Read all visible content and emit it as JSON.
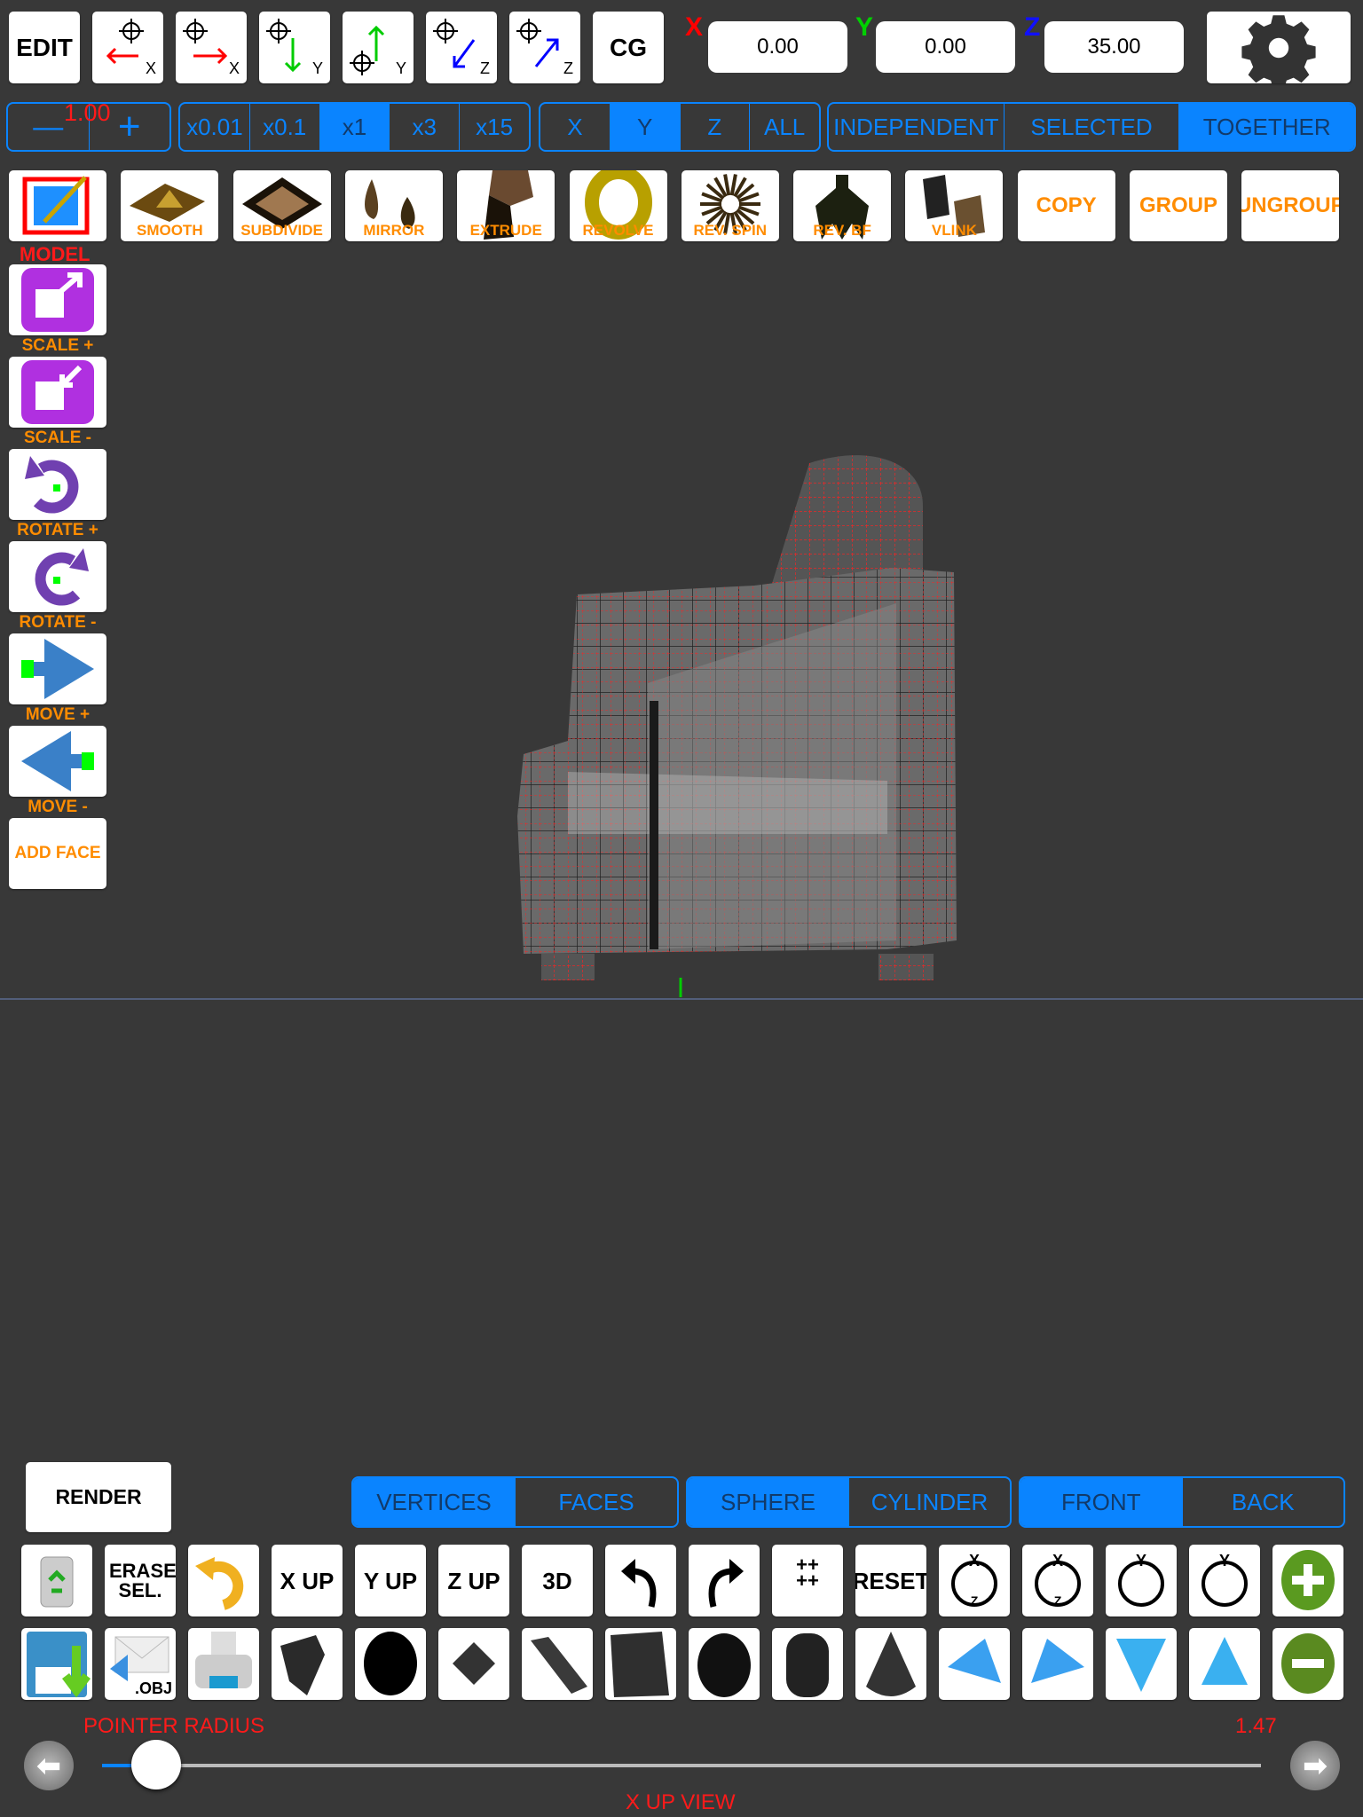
{
  "top_toolbar": {
    "edit_label": "EDIT",
    "cg_label": "CG",
    "axis_buttons": [
      {
        "icon": "move-pointer-left-x-icon",
        "axis": "X"
      },
      {
        "icon": "move-pointer-right-x-icon",
        "axis": "X"
      },
      {
        "icon": "move-pointer-down-y-icon",
        "axis": "Y"
      },
      {
        "icon": "move-pointer-up-y-icon",
        "axis": "Y"
      },
      {
        "icon": "move-pointer-toward-z-icon",
        "axis": "Z"
      },
      {
        "icon": "move-pointer-away-z-icon",
        "axis": "Z"
      }
    ],
    "coords": {
      "x_label": "X",
      "x_value": "0.00",
      "y_label": "Y",
      "y_value": "0.00",
      "z_label": "Z",
      "z_value": "35.00"
    },
    "settings_icon": "gear-icon"
  },
  "controls_row": {
    "stepper": {
      "minus": "—",
      "plus": "+",
      "value": "1.00"
    },
    "scale_options": [
      "x0.01",
      "x0.1",
      "x1",
      "x3",
      "x15"
    ],
    "scale_selected": "x1",
    "axis_options": [
      "X",
      "Y",
      "Z",
      "ALL"
    ],
    "axis_selected": "Y",
    "mode_options": [
      "INDEPENDENT",
      "SELECTED",
      "TOGETHER"
    ],
    "mode_selected": "TOGETHER"
  },
  "tools_row": [
    {
      "label": "",
      "icon": "model-edit-icon"
    },
    {
      "label": "SMOOTH",
      "icon": "smooth-icon"
    },
    {
      "label": "SUBDIVIDE",
      "icon": "subdivide-icon"
    },
    {
      "label": "MIRROR",
      "icon": "mirror-icon"
    },
    {
      "label": "EXTRUDE",
      "icon": "extrude-icon"
    },
    {
      "label": "REVOLVE",
      "icon": "revolve-icon"
    },
    {
      "label": "REV. SPIN",
      "icon": "rev-spin-icon"
    },
    {
      "label": "REV. BF",
      "icon": "rev-bf-icon"
    },
    {
      "label": "VLINK",
      "icon": "vlink-icon"
    },
    {
      "label": "COPY",
      "icon": ""
    },
    {
      "label": "GROUP",
      "icon": ""
    },
    {
      "label": "UNGROUP",
      "icon": ""
    }
  ],
  "model_label": "MODEL",
  "left_tools": [
    {
      "label": "SCALE +",
      "icon": "scale-up-icon"
    },
    {
      "label": "SCALE -",
      "icon": "scale-down-icon"
    },
    {
      "label": "ROTATE +",
      "icon": "rotate-ccw-icon"
    },
    {
      "label": "ROTATE -",
      "icon": "rotate-cw-icon"
    },
    {
      "label": "MOVE +",
      "icon": "move-right-icon"
    },
    {
      "label": "MOVE -",
      "icon": "move-left-icon"
    }
  ],
  "add_face_label": "ADD FACE",
  "bottom": {
    "render_label": "RENDER",
    "select_type": {
      "options": [
        "VERTICES",
        "FACES"
      ],
      "selected": "VERTICES"
    },
    "brush_shape": {
      "options": [
        "SPHERE",
        "CYLINDER"
      ],
      "selected": "SPHERE"
    },
    "side": {
      "options": [
        "FRONT",
        "BACK"
      ],
      "selected": "FRONT"
    },
    "row1": [
      {
        "icon": "trash-icon",
        "label": ""
      },
      {
        "icon": "",
        "label": "ERASE SEL."
      },
      {
        "icon": "undo-arrow-icon",
        "label": ""
      },
      {
        "icon": "",
        "label": "X UP"
      },
      {
        "icon": "",
        "label": "Y UP"
      },
      {
        "icon": "",
        "label": "Z UP"
      },
      {
        "icon": "",
        "label": "3D"
      },
      {
        "icon": "undo-icon",
        "label": ""
      },
      {
        "icon": "redo-icon",
        "label": ""
      },
      {
        "icon": "grid-points-icon",
        "label": ""
      },
      {
        "icon": "",
        "label": "RESET"
      },
      {
        "icon": "rotate-xz-ccw-icon",
        "label": ""
      },
      {
        "icon": "rotate-xz-cw-icon",
        "label": ""
      },
      {
        "icon": "rotate-y-ccw-icon",
        "label": ""
      },
      {
        "icon": "rotate-y-cw-icon",
        "label": ""
      },
      {
        "icon": "plus-circle-icon",
        "label": ""
      }
    ],
    "row2": [
      {
        "icon": "save-icon",
        "label": ""
      },
      {
        "icon": "mail-obj-icon",
        "label": ".OBJ"
      },
      {
        "icon": "printer-icon",
        "label": ""
      },
      {
        "icon": "plane-icon",
        "label": ""
      },
      {
        "icon": "disc-icon",
        "label": ""
      },
      {
        "icon": "square-icon",
        "label": ""
      },
      {
        "icon": "strip-icon",
        "label": ""
      },
      {
        "icon": "cube-icon",
        "label": ""
      },
      {
        "icon": "sphere-icon",
        "label": ""
      },
      {
        "icon": "cylinder-icon",
        "label": ""
      },
      {
        "icon": "cone-icon",
        "label": ""
      },
      {
        "icon": "arrow-left-blue-icon",
        "label": ""
      },
      {
        "icon": "arrow-right-blue-icon",
        "label": ""
      },
      {
        "icon": "arrow-down-blue-icon",
        "label": ""
      },
      {
        "icon": "arrow-up-blue-icon",
        "label": ""
      },
      {
        "icon": "minus-circle-icon",
        "label": ""
      }
    ],
    "pointer_radius_label": "POINTER RADIUS",
    "pointer_radius_value": "1.47",
    "slider_fraction": 0.045,
    "view_label": "X UP VIEW"
  },
  "colors": {
    "background": "#383838",
    "accent": "#0a84ff",
    "tool_label": "#ff8c00",
    "warning": "#ff1a1a"
  }
}
